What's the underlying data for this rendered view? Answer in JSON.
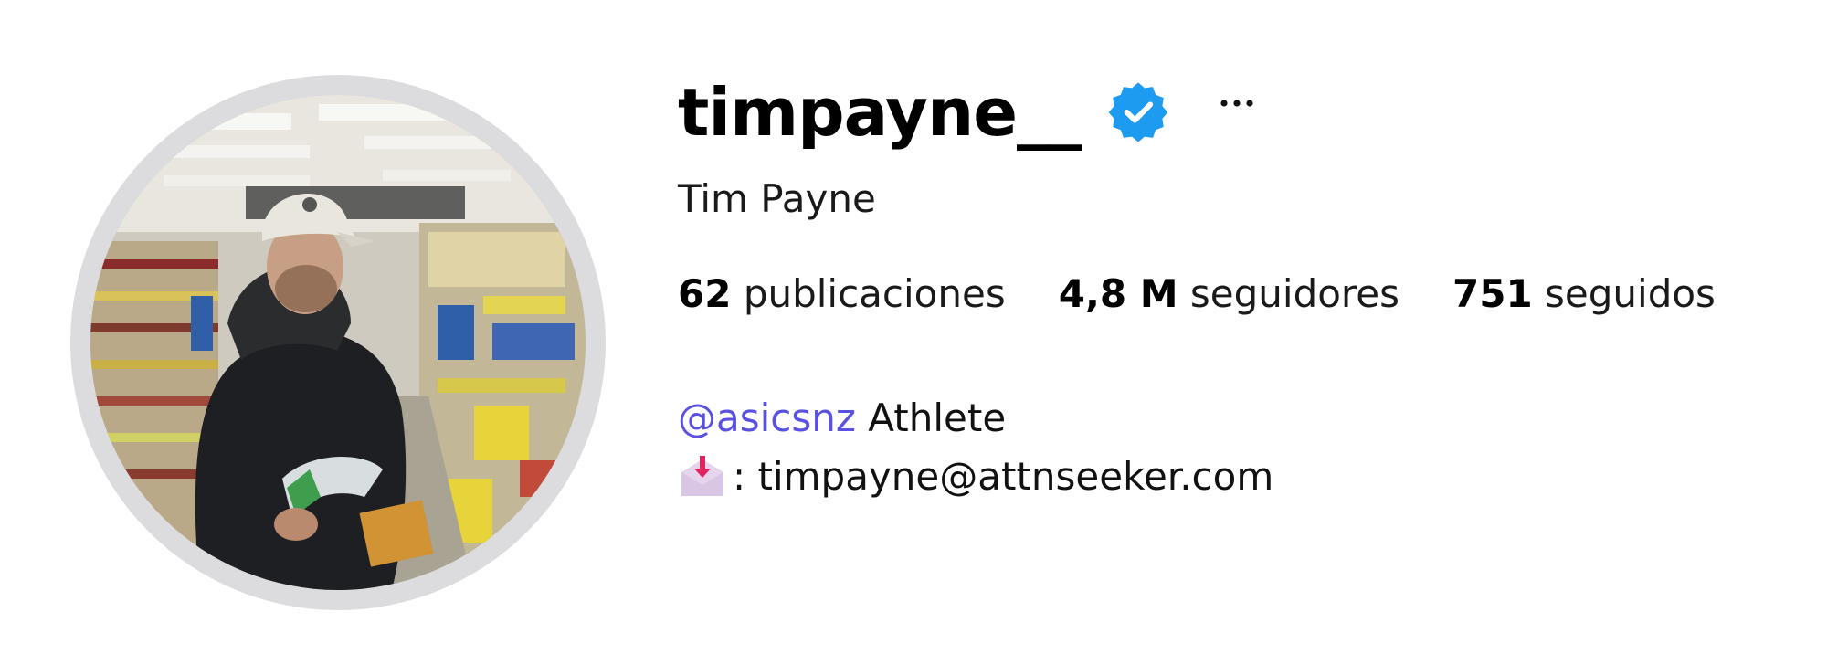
{
  "profile": {
    "username": "timpayne__",
    "verified": true,
    "verified_color": "#1d9bf0",
    "full_name": "Tim Payne",
    "stats": [
      {
        "count": "62",
        "label": "publicaciones"
      },
      {
        "count": "4,8 M",
        "label": "seguidores"
      },
      {
        "count": "751",
        "label": "seguidos"
      }
    ],
    "bio": {
      "mention": "@asicsnz",
      "line1_rest": " Athlete",
      "inbox_icon": "incoming-envelope-icon",
      "line2_text": ": timpayne@attnseeker.com"
    },
    "more_icon": "more-options-icon",
    "link_color": "#5b51e0"
  }
}
